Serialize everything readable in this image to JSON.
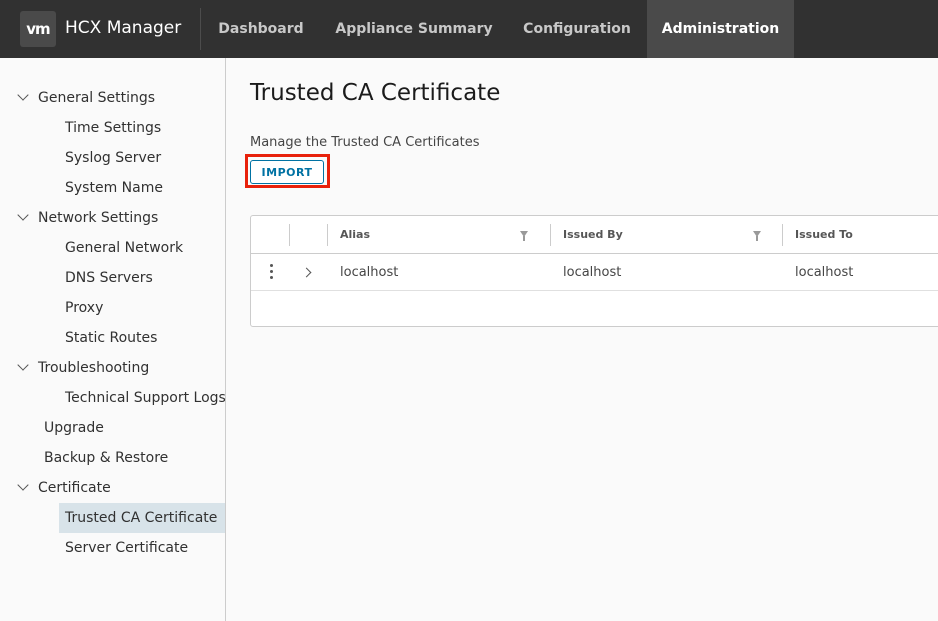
{
  "header": {
    "logo_text": "vm",
    "app_title": "HCX Manager",
    "tabs": [
      {
        "label": "Dashboard"
      },
      {
        "label": "Appliance Summary"
      },
      {
        "label": "Configuration"
      },
      {
        "label": "Administration",
        "active": true
      }
    ]
  },
  "sidebar": {
    "groups": [
      {
        "label": "General Settings",
        "items": [
          "Time Settings",
          "Syslog Server",
          "System Name"
        ]
      },
      {
        "label": "Network Settings",
        "items": [
          "General Network",
          "DNS Servers",
          "Proxy",
          "Static Routes"
        ]
      },
      {
        "label": "Troubleshooting",
        "items": [
          "Technical Support Logs"
        ]
      },
      {
        "label": "Certificate",
        "items": [
          "Trusted CA Certificate",
          "Server Certificate"
        ]
      }
    ],
    "standalone": [
      "Upgrade",
      "Backup & Restore"
    ],
    "active_item": "Trusted CA Certificate"
  },
  "main": {
    "title": "Trusted CA Certificate",
    "subtitle": "Manage the Trusted CA Certificates",
    "import_label": "IMPORT",
    "table": {
      "columns": [
        "Alias",
        "Issued By",
        "Issued To"
      ],
      "rows": [
        {
          "alias": "localhost",
          "issued_by": "localhost",
          "issued_to": "localhost"
        }
      ]
    }
  },
  "colors": {
    "header_bg": "#313131",
    "active_tab_bg": "#4a4a4a",
    "accent": "#0072a3",
    "highlight": "#e8210b",
    "active_side_bg": "#d8e3e9"
  }
}
